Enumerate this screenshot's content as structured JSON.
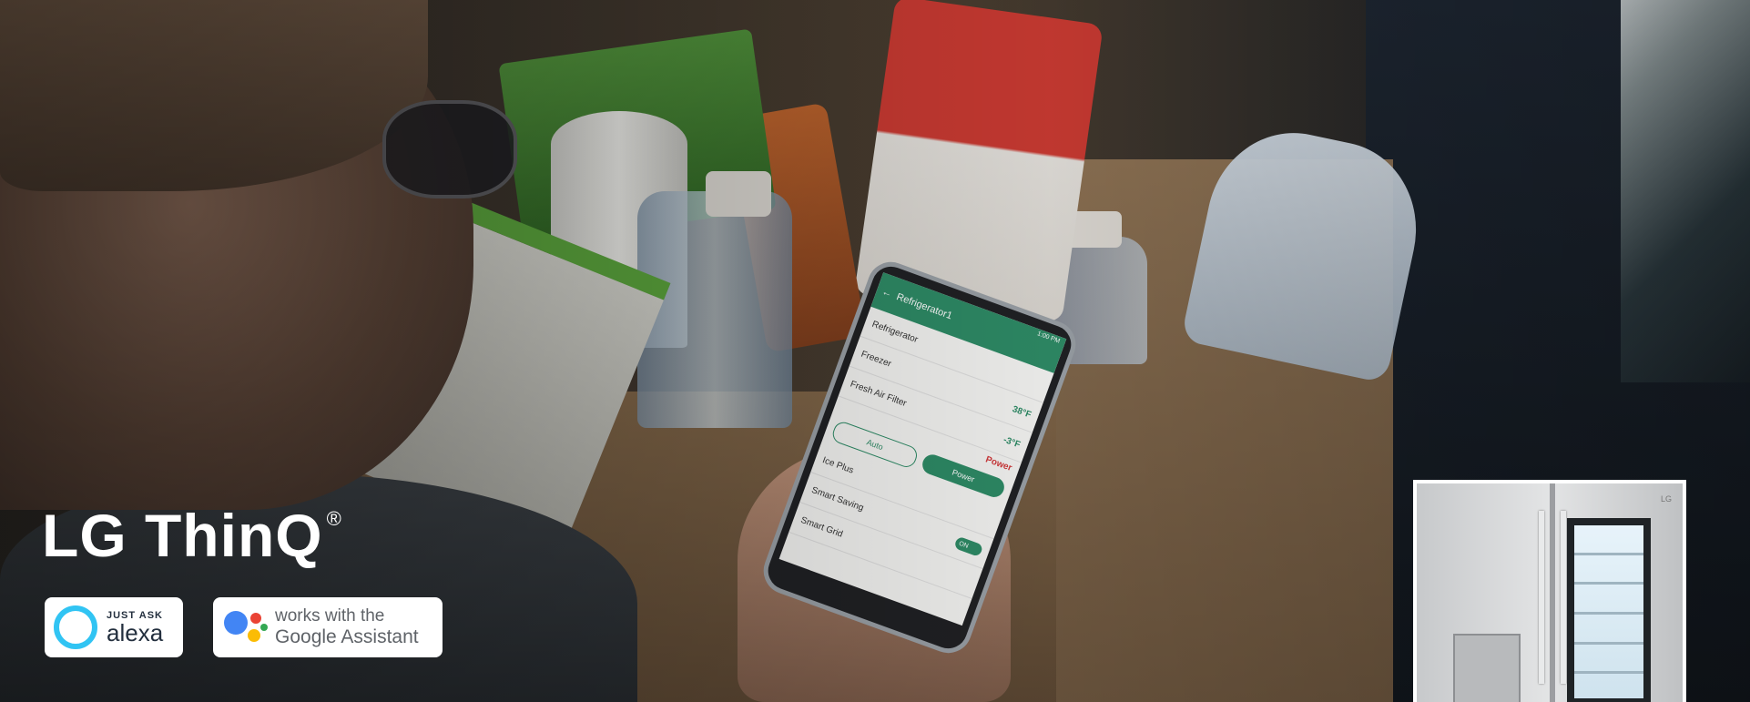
{
  "brand": {
    "name": "LG ThinQ",
    "mark": "®"
  },
  "badges": {
    "alexa": {
      "small": "JUST ASK",
      "big": "alexa"
    },
    "google": {
      "line1": "works with the",
      "line2": "Google Assistant"
    }
  },
  "phone_app": {
    "header_title": "Refrigerator1",
    "status_time": "1:00 PM",
    "section_label": "Refrigerator",
    "rows": {
      "freezer": {
        "label": "Freezer",
        "value": "38°F"
      },
      "fresh_air": {
        "label": "Fresh Air Filter",
        "value": "-3°F"
      },
      "power_label": "Power",
      "auto_button": "Auto",
      "power_button": "Power",
      "ice_plus": "Ice Plus",
      "smart_saving": {
        "label": "Smart Saving",
        "toggle": "ON"
      },
      "smart_grid": "Smart Grid"
    }
  },
  "fridge": {
    "brand": "LG"
  },
  "colors": {
    "alexa_ring": "#31c4f3",
    "app_green": "#2e8b66",
    "google_blue": "#4285f4",
    "google_red": "#ea4335",
    "google_yellow": "#fbbc05",
    "google_green": "#34a853"
  }
}
